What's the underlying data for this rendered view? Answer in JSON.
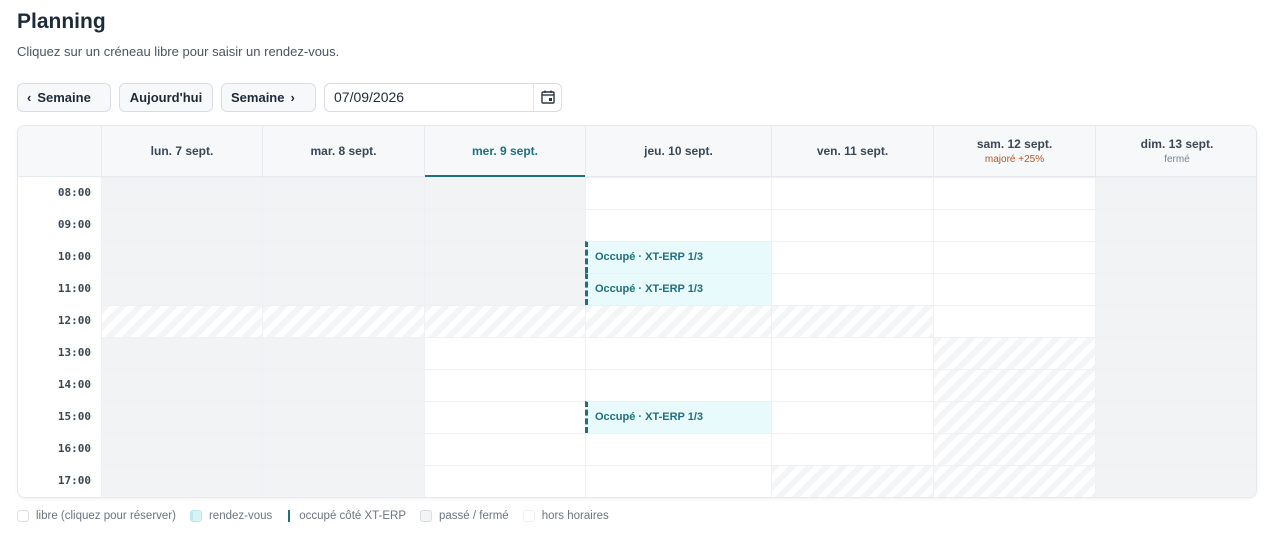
{
  "header": {
    "title": "Planning",
    "subtitle": "Cliquez sur un créneau libre pour saisir un rendez-vous."
  },
  "toolbar": {
    "prev_label": "Semaine",
    "today_label": "Aujourd'hui",
    "next_label": "Semaine",
    "date_value": "07/09/2026"
  },
  "days": [
    {
      "label": "lun. 7 sept.",
      "note": ""
    },
    {
      "label": "mar. 8 sept.",
      "note": ""
    },
    {
      "label": "mer. 9 sept.",
      "note": ""
    },
    {
      "label": "jeu. 10 sept.",
      "note": ""
    },
    {
      "label": "ven. 11 sept.",
      "note": ""
    },
    {
      "label": "sam. 12 sept.",
      "note": "majoré +25%"
    },
    {
      "label": "dim. 13 sept.",
      "note": "fermé"
    }
  ],
  "times": [
    "08:00",
    "09:00",
    "10:00",
    "11:00",
    "12:00",
    "13:00",
    "14:00",
    "15:00",
    "16:00",
    "17:00"
  ],
  "slots": [
    [
      "past",
      "past",
      "past",
      "free",
      "free",
      "free",
      "closed"
    ],
    [
      "past",
      "past",
      "past",
      "free",
      "free",
      "free",
      "closed"
    ],
    [
      "past",
      "past",
      "past",
      "busy",
      "free",
      "free",
      "closed"
    ],
    [
      "past",
      "past",
      "past",
      "busy",
      "free",
      "free",
      "closed"
    ],
    [
      "off",
      "off",
      "off",
      "off",
      "off",
      "free",
      "closed"
    ],
    [
      "past",
      "past",
      "free",
      "free",
      "free",
      "off",
      "closed"
    ],
    [
      "past",
      "past",
      "free",
      "free",
      "free",
      "off",
      "closed"
    ],
    [
      "past",
      "past",
      "free",
      "busy",
      "free",
      "off",
      "closed"
    ],
    [
      "past",
      "past",
      "free",
      "free",
      "free",
      "off",
      "closed"
    ],
    [
      "past",
      "past",
      "free",
      "free",
      "off",
      "off",
      "closed"
    ]
  ],
  "busy_label": "Occupé · XT-ERP 1/3",
  "legend": {
    "free": "libre (cliquez pour réserver)",
    "rdv": "rendez-vous",
    "ext": "occupé côté XT-ERP",
    "past": "passé / fermé",
    "off": "hors horaires"
  },
  "colors": {
    "accent": "#1f6f7d",
    "weekend_note": "#b5561f",
    "closed_note": "#7a838d",
    "busy_bg": "#e8fafc"
  }
}
